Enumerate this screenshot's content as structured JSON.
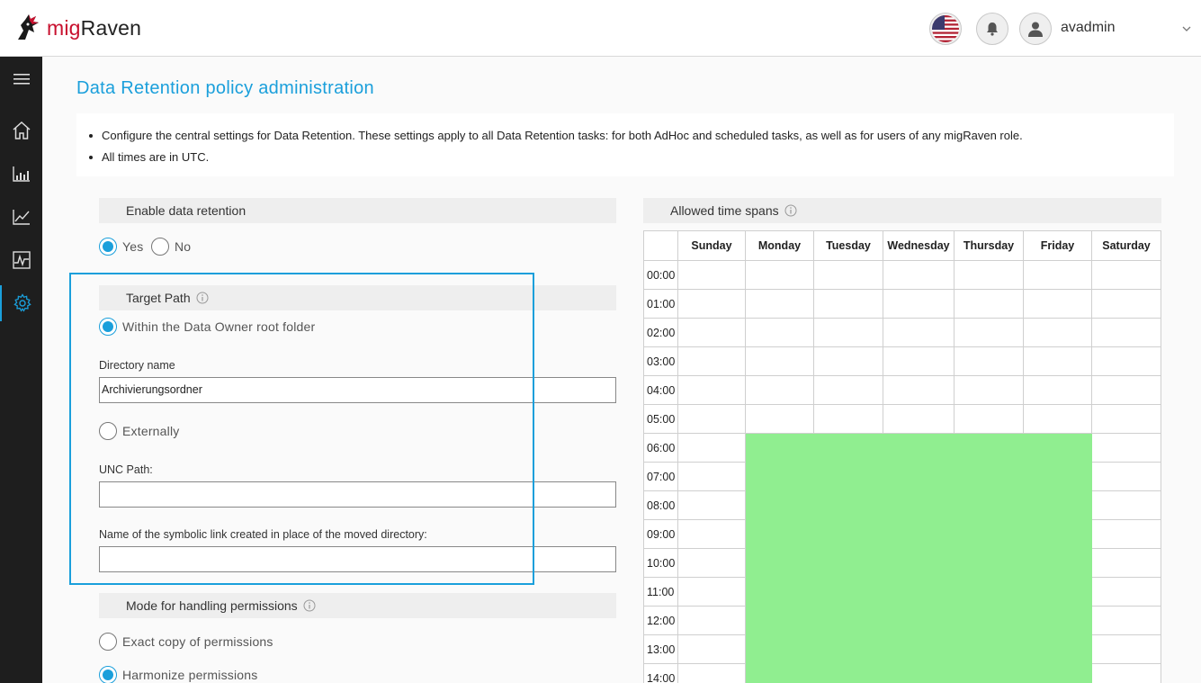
{
  "header": {
    "brand_prefix": "mig",
    "brand_suffix": "Raven",
    "user_name": "avadmin",
    "icons": [
      "flag-us-icon",
      "bell-icon",
      "user-icon",
      "chevron-down-icon"
    ]
  },
  "sidebar": {
    "items": [
      {
        "name": "menu-icon"
      },
      {
        "name": "home-icon"
      },
      {
        "name": "bar-chart-icon"
      },
      {
        "name": "line-chart-icon"
      },
      {
        "name": "activity-chart-icon"
      },
      {
        "name": "settings-icon",
        "active": true
      }
    ]
  },
  "page": {
    "title": "Data Retention policy administration",
    "notes": [
      "Configure the central settings for Data Retention. These settings apply to all Data Retention tasks: for both AdHoc and scheduled tasks, as well as for users of any migRaven role.",
      "All times are in UTC."
    ]
  },
  "enable_section": {
    "title": "Enable data retention",
    "yes_label": "Yes",
    "no_label": "No",
    "selected": "Yes"
  },
  "target_section": {
    "title": "Target Path",
    "within_label": "Within the Data Owner root folder",
    "directory_label": "Directory name",
    "directory_value": "Archivierungsordner",
    "externally_label": "Externally",
    "unc_label": "UNC Path:",
    "unc_value": "",
    "symlink_label": "Name of the symbolic link created in place of the moved directory:",
    "symlink_value": "",
    "selected": "Within the Data Owner root folder"
  },
  "permissions_section": {
    "title": "Mode for handling permissions",
    "exact_label": "Exact copy of permissions",
    "harmonize_label": "Harmonize permissions",
    "selected": "Harmonize permissions"
  },
  "schedule": {
    "title": "Allowed time spans",
    "days": [
      "Sunday",
      "Monday",
      "Tuesday",
      "Wednesday",
      "Thursday",
      "Friday",
      "Saturday"
    ],
    "hours": [
      "00:00",
      "01:00",
      "02:00",
      "03:00",
      "04:00",
      "05:00",
      "06:00",
      "07:00",
      "08:00",
      "09:00",
      "10:00",
      "11:00",
      "12:00",
      "13:00",
      "14:00"
    ],
    "allowed_days": [
      "Monday",
      "Tuesday",
      "Wednesday",
      "Thursday",
      "Friday"
    ],
    "allowed_from_hour": "06:00",
    "allowed_color": "#90ee90"
  },
  "colors": {
    "accent": "#1a9fdb",
    "sidebar_bg": "#1e1e1e",
    "brand_red": "#c8102e"
  }
}
